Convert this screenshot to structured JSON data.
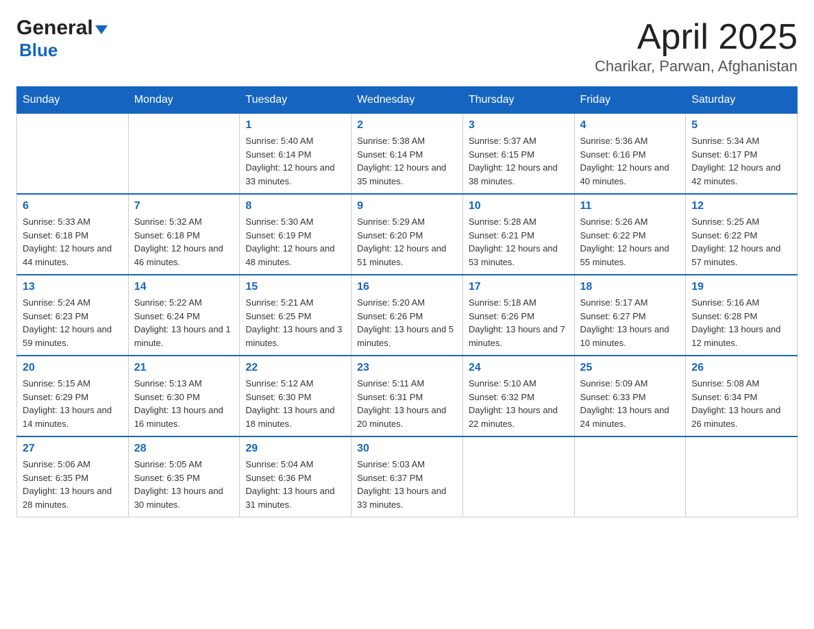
{
  "header": {
    "logo_general": "General",
    "logo_blue": "Blue",
    "title": "April 2025",
    "subtitle": "Charikar, Parwan, Afghanistan"
  },
  "weekdays": [
    "Sunday",
    "Monday",
    "Tuesday",
    "Wednesday",
    "Thursday",
    "Friday",
    "Saturday"
  ],
  "weeks": [
    [
      {
        "day": "",
        "sunrise": "",
        "sunset": "",
        "daylight": ""
      },
      {
        "day": "",
        "sunrise": "",
        "sunset": "",
        "daylight": ""
      },
      {
        "day": "1",
        "sunrise": "Sunrise: 5:40 AM",
        "sunset": "Sunset: 6:14 PM",
        "daylight": "Daylight: 12 hours and 33 minutes."
      },
      {
        "day": "2",
        "sunrise": "Sunrise: 5:38 AM",
        "sunset": "Sunset: 6:14 PM",
        "daylight": "Daylight: 12 hours and 35 minutes."
      },
      {
        "day": "3",
        "sunrise": "Sunrise: 5:37 AM",
        "sunset": "Sunset: 6:15 PM",
        "daylight": "Daylight: 12 hours and 38 minutes."
      },
      {
        "day": "4",
        "sunrise": "Sunrise: 5:36 AM",
        "sunset": "Sunset: 6:16 PM",
        "daylight": "Daylight: 12 hours and 40 minutes."
      },
      {
        "day": "5",
        "sunrise": "Sunrise: 5:34 AM",
        "sunset": "Sunset: 6:17 PM",
        "daylight": "Daylight: 12 hours and 42 minutes."
      }
    ],
    [
      {
        "day": "6",
        "sunrise": "Sunrise: 5:33 AM",
        "sunset": "Sunset: 6:18 PM",
        "daylight": "Daylight: 12 hours and 44 minutes."
      },
      {
        "day": "7",
        "sunrise": "Sunrise: 5:32 AM",
        "sunset": "Sunset: 6:18 PM",
        "daylight": "Daylight: 12 hours and 46 minutes."
      },
      {
        "day": "8",
        "sunrise": "Sunrise: 5:30 AM",
        "sunset": "Sunset: 6:19 PM",
        "daylight": "Daylight: 12 hours and 48 minutes."
      },
      {
        "day": "9",
        "sunrise": "Sunrise: 5:29 AM",
        "sunset": "Sunset: 6:20 PM",
        "daylight": "Daylight: 12 hours and 51 minutes."
      },
      {
        "day": "10",
        "sunrise": "Sunrise: 5:28 AM",
        "sunset": "Sunset: 6:21 PM",
        "daylight": "Daylight: 12 hours and 53 minutes."
      },
      {
        "day": "11",
        "sunrise": "Sunrise: 5:26 AM",
        "sunset": "Sunset: 6:22 PM",
        "daylight": "Daylight: 12 hours and 55 minutes."
      },
      {
        "day": "12",
        "sunrise": "Sunrise: 5:25 AM",
        "sunset": "Sunset: 6:22 PM",
        "daylight": "Daylight: 12 hours and 57 minutes."
      }
    ],
    [
      {
        "day": "13",
        "sunrise": "Sunrise: 5:24 AM",
        "sunset": "Sunset: 6:23 PM",
        "daylight": "Daylight: 12 hours and 59 minutes."
      },
      {
        "day": "14",
        "sunrise": "Sunrise: 5:22 AM",
        "sunset": "Sunset: 6:24 PM",
        "daylight": "Daylight: 13 hours and 1 minute."
      },
      {
        "day": "15",
        "sunrise": "Sunrise: 5:21 AM",
        "sunset": "Sunset: 6:25 PM",
        "daylight": "Daylight: 13 hours and 3 minutes."
      },
      {
        "day": "16",
        "sunrise": "Sunrise: 5:20 AM",
        "sunset": "Sunset: 6:26 PM",
        "daylight": "Daylight: 13 hours and 5 minutes."
      },
      {
        "day": "17",
        "sunrise": "Sunrise: 5:18 AM",
        "sunset": "Sunset: 6:26 PM",
        "daylight": "Daylight: 13 hours and 7 minutes."
      },
      {
        "day": "18",
        "sunrise": "Sunrise: 5:17 AM",
        "sunset": "Sunset: 6:27 PM",
        "daylight": "Daylight: 13 hours and 10 minutes."
      },
      {
        "day": "19",
        "sunrise": "Sunrise: 5:16 AM",
        "sunset": "Sunset: 6:28 PM",
        "daylight": "Daylight: 13 hours and 12 minutes."
      }
    ],
    [
      {
        "day": "20",
        "sunrise": "Sunrise: 5:15 AM",
        "sunset": "Sunset: 6:29 PM",
        "daylight": "Daylight: 13 hours and 14 minutes."
      },
      {
        "day": "21",
        "sunrise": "Sunrise: 5:13 AM",
        "sunset": "Sunset: 6:30 PM",
        "daylight": "Daylight: 13 hours and 16 minutes."
      },
      {
        "day": "22",
        "sunrise": "Sunrise: 5:12 AM",
        "sunset": "Sunset: 6:30 PM",
        "daylight": "Daylight: 13 hours and 18 minutes."
      },
      {
        "day": "23",
        "sunrise": "Sunrise: 5:11 AM",
        "sunset": "Sunset: 6:31 PM",
        "daylight": "Daylight: 13 hours and 20 minutes."
      },
      {
        "day": "24",
        "sunrise": "Sunrise: 5:10 AM",
        "sunset": "Sunset: 6:32 PM",
        "daylight": "Daylight: 13 hours and 22 minutes."
      },
      {
        "day": "25",
        "sunrise": "Sunrise: 5:09 AM",
        "sunset": "Sunset: 6:33 PM",
        "daylight": "Daylight: 13 hours and 24 minutes."
      },
      {
        "day": "26",
        "sunrise": "Sunrise: 5:08 AM",
        "sunset": "Sunset: 6:34 PM",
        "daylight": "Daylight: 13 hours and 26 minutes."
      }
    ],
    [
      {
        "day": "27",
        "sunrise": "Sunrise: 5:06 AM",
        "sunset": "Sunset: 6:35 PM",
        "daylight": "Daylight: 13 hours and 28 minutes."
      },
      {
        "day": "28",
        "sunrise": "Sunrise: 5:05 AM",
        "sunset": "Sunset: 6:35 PM",
        "daylight": "Daylight: 13 hours and 30 minutes."
      },
      {
        "day": "29",
        "sunrise": "Sunrise: 5:04 AM",
        "sunset": "Sunset: 6:36 PM",
        "daylight": "Daylight: 13 hours and 31 minutes."
      },
      {
        "day": "30",
        "sunrise": "Sunrise: 5:03 AM",
        "sunset": "Sunset: 6:37 PM",
        "daylight": "Daylight: 13 hours and 33 minutes."
      },
      {
        "day": "",
        "sunrise": "",
        "sunset": "",
        "daylight": ""
      },
      {
        "day": "",
        "sunrise": "",
        "sunset": "",
        "daylight": ""
      },
      {
        "day": "",
        "sunrise": "",
        "sunset": "",
        "daylight": ""
      }
    ]
  ]
}
